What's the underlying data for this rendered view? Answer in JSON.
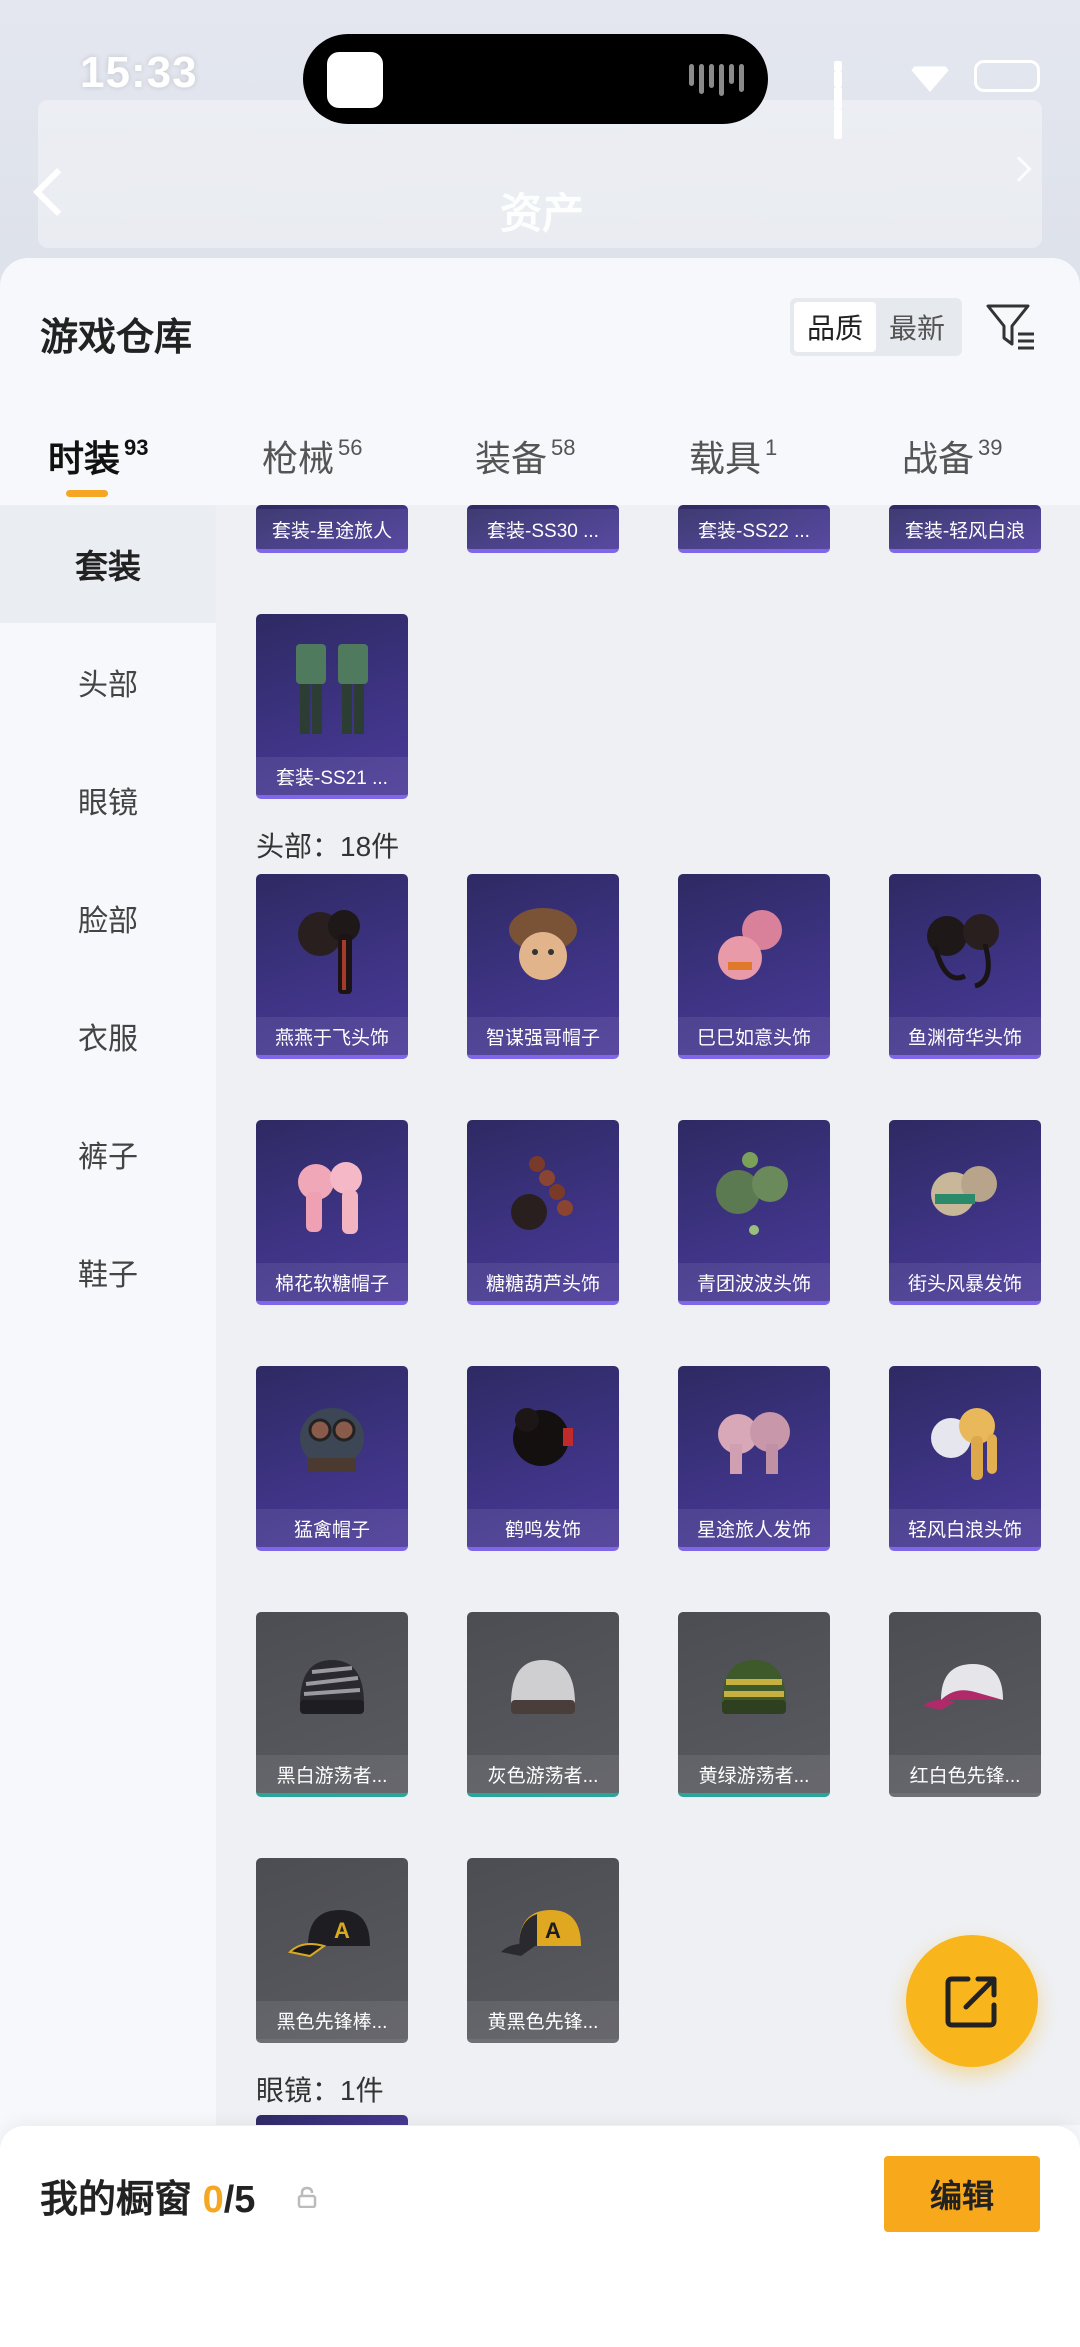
{
  "status_bar": {
    "time": "15:33"
  },
  "header": {
    "asset_label": "资产"
  },
  "sheet": {
    "title": "游戏仓库",
    "sort": {
      "quality": "品质",
      "latest": "最新"
    }
  },
  "tabs": [
    {
      "label": "时装",
      "count": "93"
    },
    {
      "label": "枪械",
      "count": "56"
    },
    {
      "label": "装备",
      "count": "58"
    },
    {
      "label": "载具",
      "count": "1"
    },
    {
      "label": "战备",
      "count": "39"
    }
  ],
  "sidebar": {
    "items": [
      {
        "label": "套装"
      },
      {
        "label": "头部"
      },
      {
        "label": "眼镜"
      },
      {
        "label": "脸部"
      },
      {
        "label": "衣服"
      },
      {
        "label": "裤子"
      },
      {
        "label": "鞋子"
      }
    ]
  },
  "sections": {
    "outfits_top": [
      "套装-星途旅人",
      "套装-SS30 ...",
      "套装-SS22 ...",
      "套装-轻风白浪"
    ],
    "outfit_last": "套装-SS21 ...",
    "head_title": "头部：18件",
    "head_items": [
      "燕燕于飞头饰",
      "智谋强哥帽子",
      "巳巳如意头饰",
      "鱼渊荷华头饰",
      "棉花软糖帽子",
      "糖糖葫芦头饰",
      "青团波波头饰",
      "街头风暴发饰",
      "猛禽帽子",
      "鹤鸣发饰",
      "星途旅人发饰",
      "轻风白浪头饰",
      "黑白游荡者...",
      "灰色游荡者...",
      "黄绿游荡者...",
      "红白色先锋...",
      "黑色先锋棒...",
      "黄黑色先锋..."
    ],
    "glasses_title": "眼镜：1件"
  },
  "showcase": {
    "label": "我的橱窗",
    "current": "0",
    "total": "/5",
    "edit": "编辑"
  },
  "colors": {
    "accent": "#f5a623",
    "purple_card": "#3f3486",
    "grey_card": "#55565c"
  }
}
